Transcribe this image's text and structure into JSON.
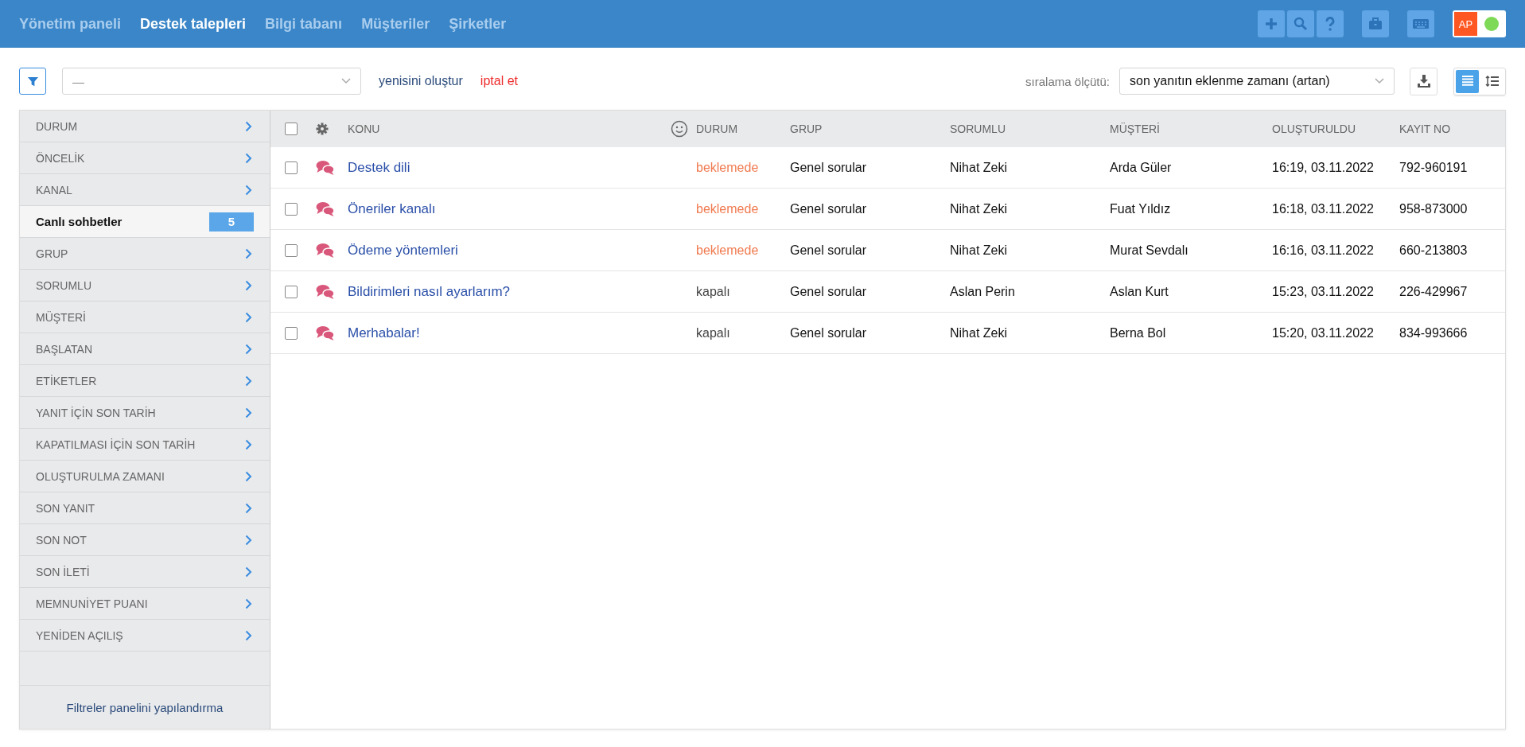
{
  "nav": [
    {
      "label": "Yönetim paneli",
      "selected": false
    },
    {
      "label": "Destek talepleri",
      "selected": true
    },
    {
      "label": "Bilgi tabanı",
      "selected": false
    },
    {
      "label": "Müşteriler",
      "selected": false
    },
    {
      "label": "Şirketler",
      "selected": false
    }
  ],
  "user": {
    "initials": "AP"
  },
  "toolbar": {
    "filter_value": "—",
    "create_link": "yenisini oluştur",
    "cancel_link": "iptal et",
    "sort_label": "sıralama ölçütü:",
    "sort_value": "son yanıtın eklenme zamanı (artan)",
    "views": [
      {
        "kind": "list",
        "selected": true
      },
      {
        "kind": "spacing",
        "selected": false
      }
    ]
  },
  "sidebar": {
    "items": [
      {
        "label": "DURUM",
        "selected": false
      },
      {
        "label": "ÖNCELİK",
        "selected": false
      },
      {
        "label": "KANAL",
        "selected": false
      },
      {
        "label": "Canlı sohbetler",
        "selected": true,
        "count": "5"
      },
      {
        "label": "GRUP",
        "selected": false
      },
      {
        "label": "SORUMLU",
        "selected": false
      },
      {
        "label": "MÜŞTERİ",
        "selected": false
      },
      {
        "label": "BAŞLATAN",
        "selected": false
      },
      {
        "label": "ETİKETLER",
        "selected": false
      },
      {
        "label": "YANIT İÇİN SON TARİH",
        "selected": false
      },
      {
        "label": "KAPATILMASI İÇİN SON TARİH",
        "selected": false
      },
      {
        "label": "OLUŞTURULMA ZAMANI",
        "selected": false
      },
      {
        "label": "SON YANIT",
        "selected": false
      },
      {
        "label": "SON NOT",
        "selected": false
      },
      {
        "label": "SON İLETİ",
        "selected": false
      },
      {
        "label": "MEMNUNİYET PUANI",
        "selected": false
      },
      {
        "label": "YENİDEN AÇILIŞ",
        "selected": false
      }
    ],
    "footer": "Filtreler panelini yapılandırma"
  },
  "table": {
    "columns": [
      "KONU",
      "DURUM",
      "GRUP",
      "SORUMLU",
      "MÜŞTERİ",
      "OLUŞTURULDU",
      "KAYIT NO"
    ],
    "select_all": false,
    "rows": [
      {
        "checked": false,
        "subject": "Destek dili",
        "status": "beklemede",
        "pending": true,
        "group": "Genel sorular",
        "assignee": "Nihat Zeki",
        "customer": "Arda Güler",
        "created": "16:19, 03.11.2022",
        "number": "792-960191"
      },
      {
        "checked": false,
        "subject": "Öneriler kanalı",
        "status": "beklemede",
        "pending": true,
        "group": "Genel sorular",
        "assignee": "Nihat Zeki",
        "customer": "Fuat Yıldız",
        "created": "16:18, 03.11.2022",
        "number": "958-873000"
      },
      {
        "checked": false,
        "subject": "Ödeme yöntemleri",
        "status": "beklemede",
        "pending": true,
        "group": "Genel sorular",
        "assignee": "Nihat Zeki",
        "customer": "Murat Sevdalı",
        "created": "16:16, 03.11.2022",
        "number": "660-213803"
      },
      {
        "checked": false,
        "subject": "Bildirimleri nasıl ayarlarım?",
        "status": "kapalı",
        "pending": false,
        "group": "Genel sorular",
        "assignee": "Aslan Perin",
        "customer": "Aslan Kurt",
        "created": "15:23, 03.11.2022",
        "number": "226-429967"
      },
      {
        "checked": false,
        "subject": "Merhabalar!",
        "status": "kapalı",
        "pending": false,
        "group": "Genel sorular",
        "assignee": "Nihat Zeki",
        "customer": "Berna Bol",
        "created": "15:20, 03.11.2022",
        "number": "834-993666"
      }
    ]
  }
}
